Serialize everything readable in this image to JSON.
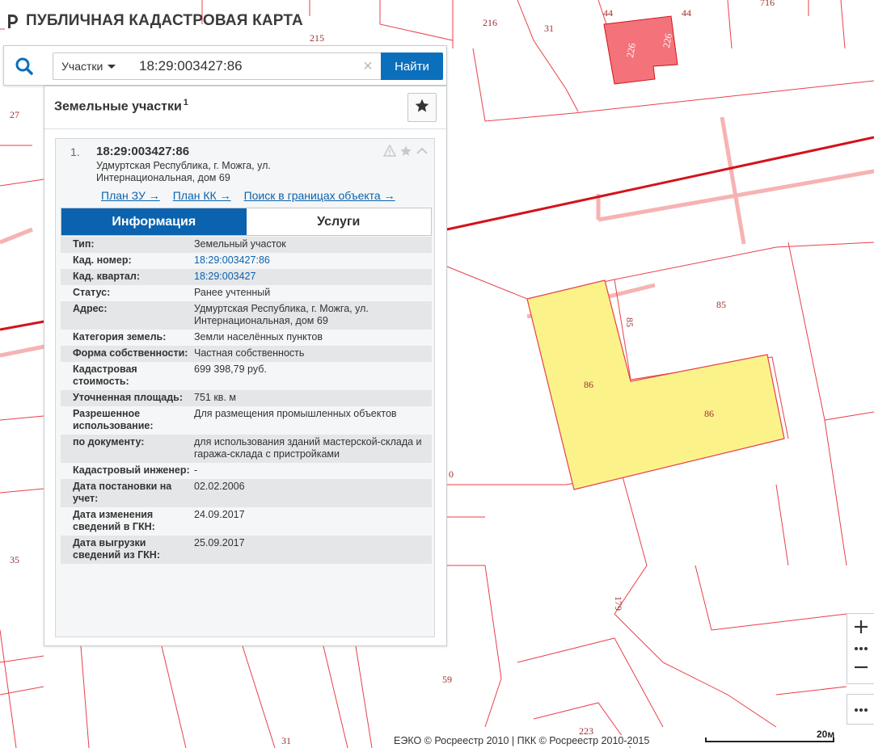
{
  "app": {
    "title": "ПУБЛИЧНАЯ КАДАСТРОВАЯ КАРТА"
  },
  "search": {
    "type_label": "Участки",
    "query": "18:29:003427:86",
    "clear_symbol": "×",
    "find_label": "Найти"
  },
  "results": {
    "title": "Земельные участки",
    "count": "1",
    "item": {
      "index": "1.",
      "number": "18:29:003427:86",
      "address": "Удмуртская Республика, г. Можга, ул. Интернациональная, дом 69",
      "links": [
        {
          "label": "План ЗУ →"
        },
        {
          "label": "План КК →"
        },
        {
          "label": "Поиск в границах объекта →"
        }
      ],
      "tabs": {
        "info": "Информация",
        "services": "Услуги"
      },
      "fields": [
        {
          "key": "Тип:",
          "value": "Земельный участок"
        },
        {
          "key": "Кад. номер:",
          "value": "18:29:003427:86"
        },
        {
          "key": "Кад. квартал:",
          "value": "18:29:003427"
        },
        {
          "key": "Статус:",
          "value": "Ранее учтенный"
        },
        {
          "key": "Адрес:",
          "value": "Удмуртская Республика, г. Можга, ул. Интернациональная, дом 69"
        },
        {
          "key": "Категория земель:",
          "value": "Земли населённых пунктов"
        },
        {
          "key": "Форма собственности:",
          "value": "Частная собственность"
        },
        {
          "key": "Кадастровая стоимость:",
          "value": "699 398,79 руб."
        },
        {
          "key": "Уточненная площадь:",
          "value": "751 кв. м"
        },
        {
          "key": "Разрешенное использование:",
          "value": "Для размещения промышленных объектов"
        },
        {
          "key": "по документу:",
          "value": "для использования зданий мастерской-склада и гаража-склада с пристройками"
        },
        {
          "key": "Кадастровый инженер:",
          "value": "-"
        },
        {
          "key": "Дата постановки на учет:",
          "value": "02.02.2006"
        },
        {
          "key": "Дата изменения сведений в ГКН:",
          "value": "24.09.2017"
        },
        {
          "key": "Дата выгрузки сведений из ГКН:",
          "value": "25.09.2017"
        }
      ]
    }
  },
  "map": {
    "labels": [
      "215",
      "216",
      "31",
      "44",
      "44",
      "716",
      "226",
      "226",
      "27",
      "85",
      "85",
      "86",
      "86",
      "0",
      "35",
      "179",
      "59",
      "223",
      "31"
    ],
    "colors": {
      "parcel_line": "#e8404a",
      "highlight_fill": "#fbf38a",
      "building_fill": "#f4737a",
      "road_line": "#d4121c",
      "boundary_band": "#f6b3b3"
    }
  },
  "controls": {
    "zoom_in": "+",
    "zoom_out": "−",
    "more": "•••"
  },
  "footer": {
    "attribution": "ЕЭКО © Росреестр 2010 | ПКК © Росреестр 2010-2015",
    "scale": "20м"
  }
}
